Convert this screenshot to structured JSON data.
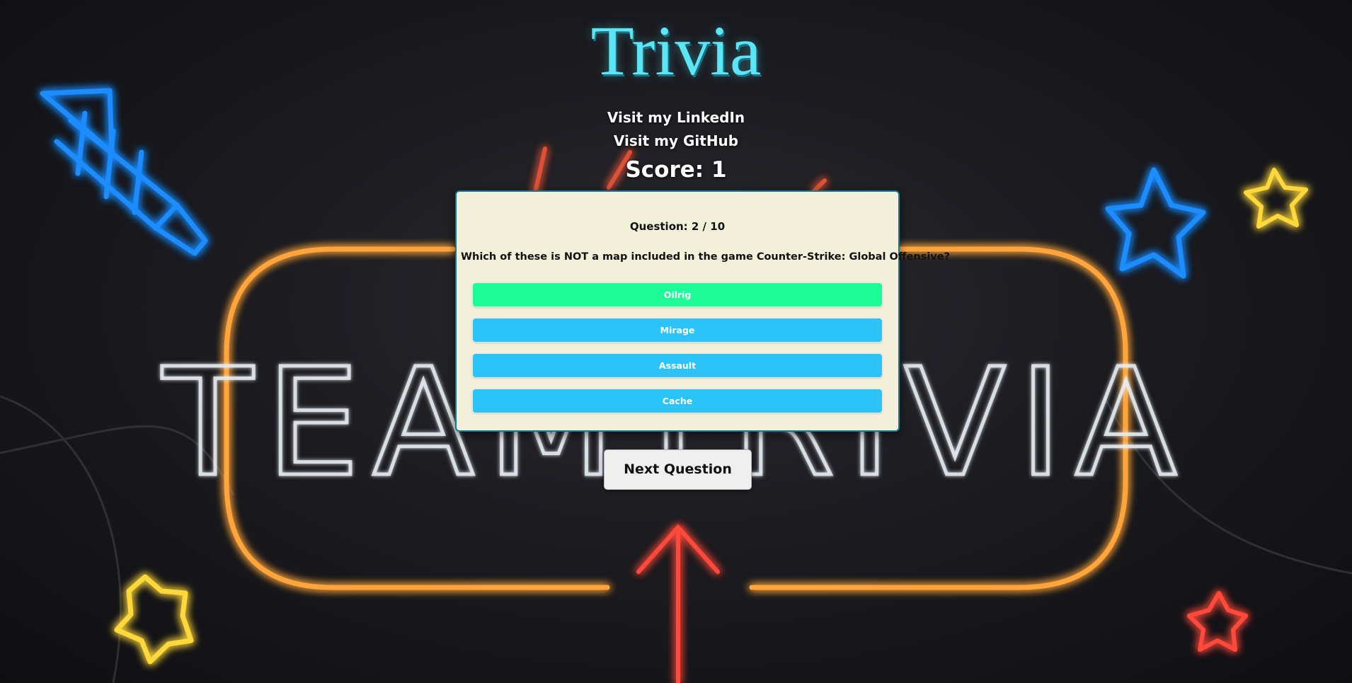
{
  "header": {
    "title": "Trivia",
    "links": [
      {
        "label": "Visit my LinkedIn"
      },
      {
        "label": "Visit my GitHub"
      }
    ],
    "score_label": "Score: 1"
  },
  "background": {
    "sign_text": "TEAM TRIVIA",
    "decorations": [
      "rocket-icon",
      "star-icon",
      "arrow-icon"
    ]
  },
  "quiz": {
    "question_number": "Question: 2 / 10",
    "question": "Which of these is NOT a map included in the game Counter-Strike: Global Offensive?",
    "answers": [
      {
        "label": "Oilrig",
        "state": "correct"
      },
      {
        "label": "Mirage",
        "state": "default"
      },
      {
        "label": "Assault",
        "state": "default"
      },
      {
        "label": "Cache",
        "state": "default"
      }
    ],
    "next_label": "Next Question"
  },
  "colors": {
    "title": "#5ce6f5",
    "card_background": "#f3f0da",
    "card_border": "#127b93",
    "answer_default": "#2bc3f8",
    "answer_correct": "#1cfd98",
    "neon_orange": "#ffa53a",
    "neon_blue": "#1e8cff",
    "neon_yellow": "#ffd83a",
    "neon_red": "#ff4a3a"
  }
}
